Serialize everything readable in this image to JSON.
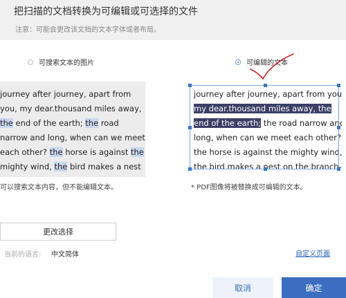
{
  "dialog": {
    "title": "把扫描的文档转换为可编辑或可选择的文件",
    "subtitle": "注意：可能会更改该文档的文本字体或者布局。"
  },
  "options": {
    "searchable_image": {
      "label": "可搜索文本的图片",
      "selected": false
    },
    "editable_text": {
      "label": "可编辑的文本",
      "selected": true
    }
  },
  "preview_left": {
    "lines": [
      [
        "journey after journey, apart from"
      ],
      [
        "you, my dear.thousand miles away,"
      ],
      [
        {
          "t": "the",
          "h": true
        },
        " end of the earth; ",
        {
          "t": "the",
          "h": true
        },
        " road"
      ],
      [
        "narrow and long, when can we meet"
      ],
      [
        "each other? ",
        {
          "t": "the",
          "h": true
        },
        " horse is against ",
        {
          "t": "the",
          "h": true
        }
      ],
      [
        "mighty wind, ",
        {
          "t": "the",
          "h": true
        },
        " bird makes a nest"
      ]
    ],
    "caption": "可以搜索文本内容，但不能编辑文本。"
  },
  "preview_right": {
    "lines": [
      [
        "journey after journey, apart from you,"
      ],
      [
        {
          "t": "my dear.thousand miles away, the",
          "s": true
        }
      ],
      [
        {
          "t": "end of the earth;",
          "s": true
        },
        " the road narrow and"
      ],
      [
        "long, when can we meet each other?"
      ],
      [
        "the horse is against the mighty wind,"
      ],
      [
        "the bird makes a nest on the branch-"
      ]
    ],
    "caption": "* PDF图像将被替换成可编辑的文本。"
  },
  "change_button": {
    "label": "更改选择"
  },
  "language": {
    "label": "当前的语言:",
    "value": "中文简体"
  },
  "custom_page_link": {
    "label": "自定义页面"
  },
  "footer": {
    "cancel_label": "取消",
    "ok_label": "确定"
  },
  "colors": {
    "accent": "#3b6ec0",
    "selection": "#3b3f66",
    "search_highlight": "#c9d6ee",
    "annotation": "#d0262a"
  }
}
